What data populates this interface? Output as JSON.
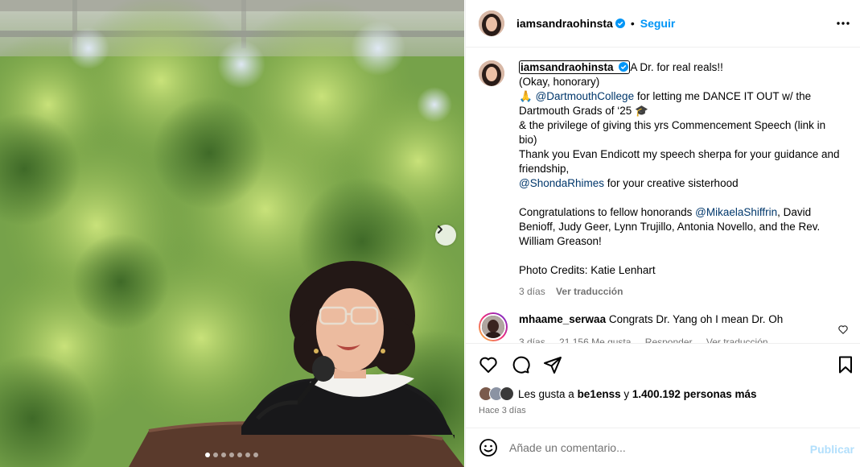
{
  "post": {
    "username": "iamsandraohinsta",
    "dot": "•",
    "follow_label": "Seguir"
  },
  "caption": {
    "username": "iamsandraohinsta",
    "line1": "A Dr. for real reals!!",
    "line2": "(Okay, honorary)",
    "line3_pre": "🙏 ",
    "mention_dartmouth": "@DartmouthCollege",
    "line3_post": " for letting me DANCE IT OUT w/ the Dartmouth Grads of ‘25 🎓",
    "line4": "& the privilege of giving this yrs Commencement Speech (link in bio)",
    "line5": "Thank you Evan Endicott my speech sherpa for your guidance and friendship,",
    "mention_shonda": "@ShondaRhimes",
    "line6_post": " for your creative sisterhood",
    "line7_pre": "Congratulations to fellow honorands ",
    "mention_mikaela": "@MikaelaShiffrin",
    "line7_post": ", David Benioff, Judy Geer, Lynn Trujillo, Antonia Novello, and the Rev. William Greason!",
    "line8": "Photo Credits: Katie Lenhart",
    "time": "3 días",
    "translate": "Ver traducción"
  },
  "comment": {
    "username": "mhaame_serwaa",
    "text": "Congrats Dr. Yang oh I mean Dr. Oh",
    "time": "3 días",
    "likes": "21.156 Me gusta",
    "reply": "Responder",
    "translate": "Ver traducción"
  },
  "likes": {
    "prefix": "Les gusta a ",
    "user": "be1enss",
    "middle": " y ",
    "count": "1.400.192 personas más"
  },
  "post_date": "Hace 3 días",
  "add_comment": {
    "placeholder": "Añade un comentario...",
    "publish_label": "Publicar"
  },
  "carousel": {
    "total": 7,
    "current": 1
  },
  "colors": {
    "accent": "#0095f6",
    "mention": "#00376b",
    "muted": "#737373"
  }
}
